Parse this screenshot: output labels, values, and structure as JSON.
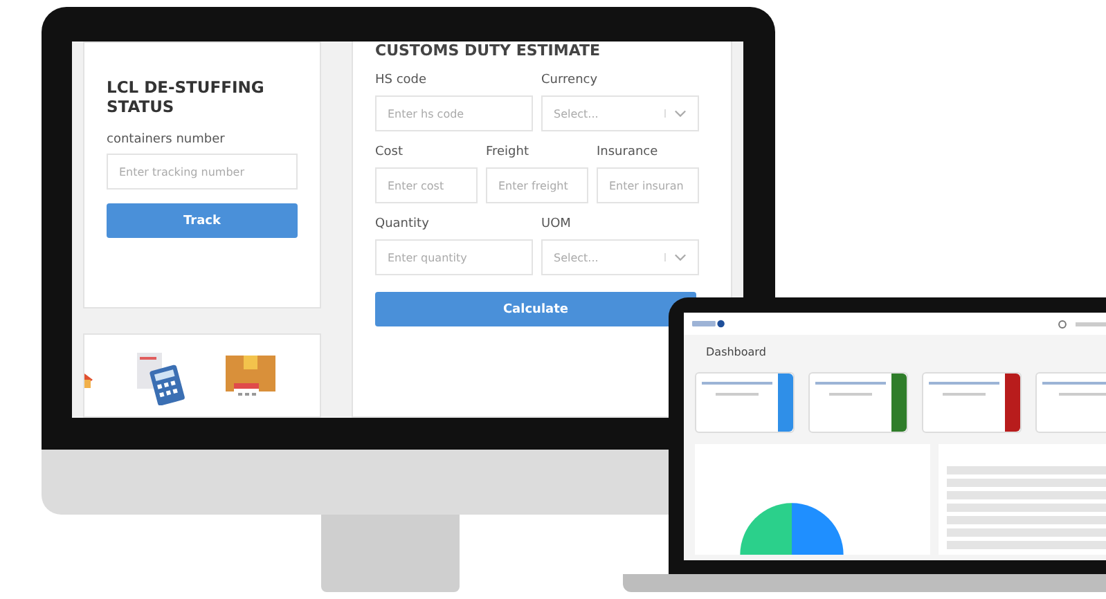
{
  "tracking_card": {
    "title": "LCL DE-STUFFING STATUS",
    "field_label": "containers number",
    "placeholder": "Enter tracking number",
    "button": "Track"
  },
  "customs_form": {
    "title": "CUSTOMS DUTY ESTIMATE",
    "rows": [
      {
        "fields": [
          {
            "kind": "text",
            "label": "HS code",
            "placeholder": "Enter hs code"
          },
          {
            "kind": "select",
            "label": "Currency",
            "placeholder": "Select..."
          }
        ]
      },
      {
        "fields": [
          {
            "kind": "text",
            "label": "Cost",
            "placeholder": "Enter cost"
          },
          {
            "kind": "text",
            "label": "Freight",
            "placeholder": "Enter freight"
          },
          {
            "kind": "text",
            "label": "Insurance",
            "placeholder": "Enter insuran"
          }
        ]
      },
      {
        "fields": [
          {
            "kind": "text",
            "label": "Quantity",
            "placeholder": "Enter quantity"
          },
          {
            "kind": "select",
            "label": "UOM",
            "placeholder": "Select..."
          }
        ]
      }
    ],
    "button": "Calculate"
  },
  "laptop": {
    "page_title": "Dashboard",
    "stat_cards": [
      {
        "color": "#2f8fe8"
      },
      {
        "color": "#2f7d2a"
      },
      {
        "color": "#b81c1c"
      }
    ]
  }
}
